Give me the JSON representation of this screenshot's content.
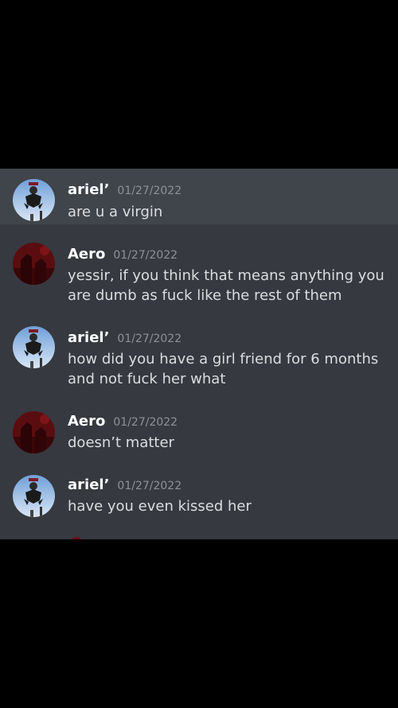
{
  "colors": {
    "background": "#000000",
    "chat_background": "#36393f",
    "highlight_background": "#40444b",
    "author": "#ffffff",
    "timestamp": "#8e9297",
    "message_text": "#dcddde"
  },
  "messages": [
    {
      "author": "ariel’",
      "timestamp": "01/27/2022",
      "text": "are u a virgin",
      "avatar": "ariel-avatar-icon",
      "highlighted": true
    },
    {
      "author": "Aero",
      "timestamp": "01/27/2022",
      "text": "yessir, if you think that means anything you are dumb as fuck like the rest of them",
      "avatar": "aero-avatar-icon"
    },
    {
      "author": "ariel’",
      "timestamp": "01/27/2022",
      "text": "how did you have a girl friend for 6 months and not fuck her what",
      "avatar": "ariel-avatar-icon"
    },
    {
      "author": "Aero",
      "timestamp": "01/27/2022",
      "text": "doesn’t matter",
      "avatar": "aero-avatar-icon"
    },
    {
      "author": "ariel’",
      "timestamp": "01/27/2022",
      "text": "have you even kissed her",
      "avatar": "ariel-avatar-icon"
    }
  ]
}
